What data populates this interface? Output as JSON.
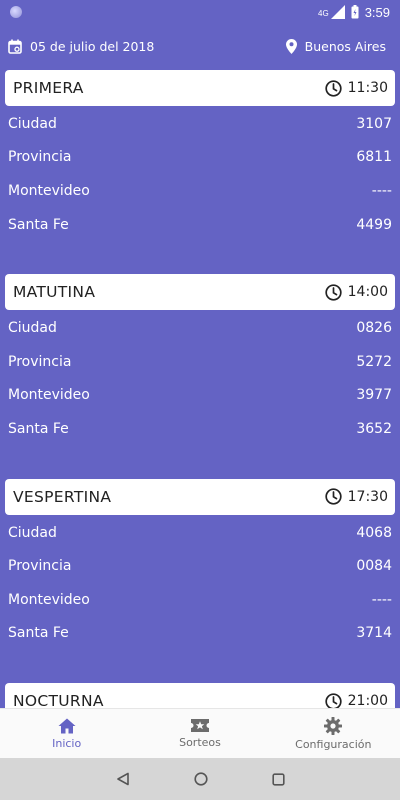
{
  "status_bar": {
    "time": "3:59",
    "network": "4G"
  },
  "header": {
    "date": "05 de julio del 2018",
    "location": "Buenos Aires"
  },
  "sections": [
    {
      "title": "PRIMERA",
      "time": "11:30",
      "rows": [
        {
          "label": "Ciudad",
          "value": "3107"
        },
        {
          "label": "Provincia",
          "value": "6811"
        },
        {
          "label": "Montevideo",
          "value": "----"
        },
        {
          "label": "Santa Fe",
          "value": "4499"
        }
      ]
    },
    {
      "title": "MATUTINA",
      "time": "14:00",
      "rows": [
        {
          "label": "Ciudad",
          "value": "0826"
        },
        {
          "label": "Provincia",
          "value": "5272"
        },
        {
          "label": "Montevideo",
          "value": "3977"
        },
        {
          "label": "Santa Fe",
          "value": "3652"
        }
      ]
    },
    {
      "title": "VESPERTINA",
      "time": "17:30",
      "rows": [
        {
          "label": "Ciudad",
          "value": "4068"
        },
        {
          "label": "Provincia",
          "value": "0084"
        },
        {
          "label": "Montevideo",
          "value": "----"
        },
        {
          "label": "Santa Fe",
          "value": "3714"
        }
      ]
    },
    {
      "title": "NOCTURNA",
      "time": "21:00",
      "rows": []
    }
  ],
  "bottom_nav": {
    "items": [
      {
        "label": "Inicio",
        "icon": "home-icon"
      },
      {
        "label": "Sorteos",
        "icon": "ticket-icon"
      },
      {
        "label": "Configuración",
        "icon": "gear-icon"
      }
    ]
  },
  "colors": {
    "background": "#6463C4",
    "card": "#ffffff",
    "nav_active": "#6463C4",
    "nav_inactive": "#6c6c6c"
  }
}
